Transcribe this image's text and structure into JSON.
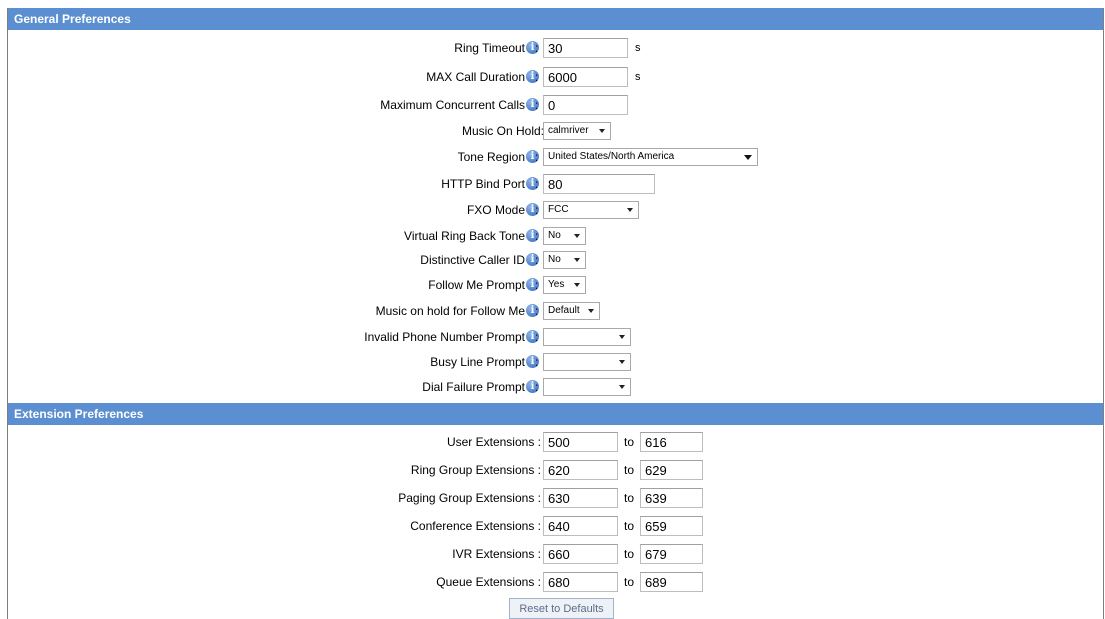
{
  "general": {
    "header": "General Preferences",
    "ring_timeout": {
      "label": "Ring Timeout",
      "value": "30",
      "unit": "s"
    },
    "max_call_duration": {
      "label": "MAX Call Duration",
      "value": "6000",
      "unit": "s"
    },
    "max_concurrent_calls": {
      "label": "Maximum Concurrent Calls",
      "value": "0"
    },
    "music_on_hold": {
      "label": "Music On Hold:",
      "value": "calmriver"
    },
    "tone_region": {
      "label": "Tone Region",
      "value": "United States/North America"
    },
    "http_bind_port": {
      "label": "HTTP Bind Port",
      "value": "80"
    },
    "fxo_mode": {
      "label": "FXO Mode",
      "value": "FCC"
    },
    "virtual_ring_back_tone": {
      "label": "Virtual Ring Back Tone",
      "value": "No"
    },
    "distinctive_caller_id": {
      "label": "Distinctive Caller ID",
      "value": "No"
    },
    "follow_me_prompt": {
      "label": "Follow Me Prompt",
      "value": "Yes"
    },
    "music_on_hold_follow_me": {
      "label": "Music on hold for Follow Me",
      "value": "Default"
    },
    "invalid_phone_number_prompt": {
      "label": "Invalid Phone Number Prompt",
      "value": ""
    },
    "busy_line_prompt": {
      "label": "Busy Line Prompt",
      "value": ""
    },
    "dial_failure_prompt": {
      "label": "Dial Failure Prompt",
      "value": ""
    }
  },
  "extensions": {
    "header": "Extension Preferences",
    "to_label": "to",
    "user": {
      "label": "User Extensions :",
      "from": "500",
      "to": "616"
    },
    "ring_group": {
      "label": "Ring Group Extensions :",
      "from": "620",
      "to": "629"
    },
    "paging_group": {
      "label": "Paging Group Extensions :",
      "from": "630",
      "to": "639"
    },
    "conference": {
      "label": "Conference Extensions :",
      "from": "640",
      "to": "659"
    },
    "ivr": {
      "label": "IVR Extensions :",
      "from": "660",
      "to": "679"
    },
    "queue": {
      "label": "Queue Extensions :",
      "from": "680",
      "to": "689"
    }
  },
  "reset_button": "Reset to Defaults",
  "icons": {
    "info": "info-icon",
    "dropdown": "chevron-down-icon"
  }
}
